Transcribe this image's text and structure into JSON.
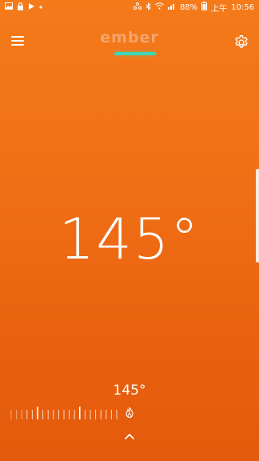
{
  "status_bar": {
    "left_icons": [
      "image-icon",
      "lock-icon",
      "play-store-icon",
      "dot-icon"
    ],
    "right_icons": [
      "network-icon",
      "bluetooth-icon",
      "wifi-icon",
      "signal-icon",
      "battery-icon"
    ],
    "battery_percent": "88%",
    "time_period": "上午",
    "time": "10:56"
  },
  "header": {
    "logo_text": "ember",
    "menu_icon": "hamburger-menu-icon",
    "settings_icon": "gear-icon",
    "accent_color": "#3fd7b5"
  },
  "main": {
    "current_temperature": "145°"
  },
  "controls": {
    "target_temperature": "145°",
    "flame_icon": "flame-icon",
    "expand_icon": "chevron-up-icon"
  },
  "colors": {
    "background_top": "#f47a1a",
    "background_bottom": "#e45a0c"
  }
}
